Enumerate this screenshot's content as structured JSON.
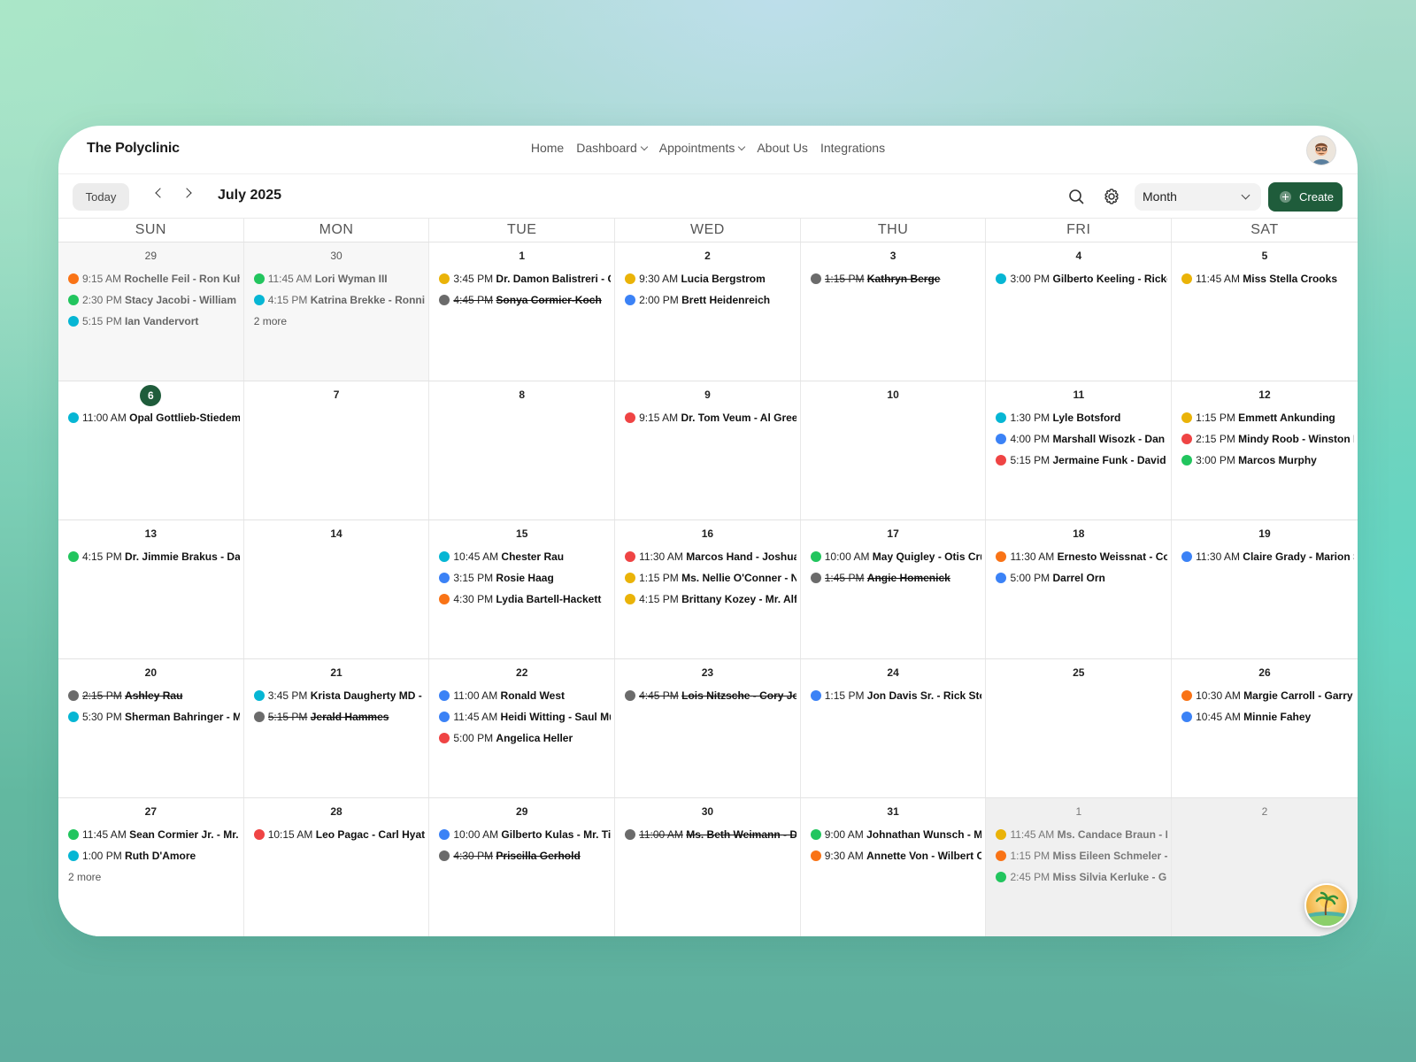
{
  "app": {
    "brand": "The Polyclinic"
  },
  "nav": {
    "items": [
      {
        "label": "Home",
        "dropdown": false
      },
      {
        "label": "Dashboard",
        "dropdown": true
      },
      {
        "label": "Appointments",
        "dropdown": true
      },
      {
        "label": "About Us",
        "dropdown": false
      },
      {
        "label": "Integrations",
        "dropdown": false
      }
    ]
  },
  "toolbar": {
    "today_label": "Today",
    "month_title": "July 2025",
    "view_value": "Month",
    "create_label": "Create"
  },
  "colors": {
    "orange": "#f97316",
    "green": "#22c55e",
    "cyan": "#06b6d4",
    "yellow": "#eab308",
    "gray": "#6b6b6b",
    "blue": "#3b82f6",
    "red": "#ef4444",
    "accent": "#1f5c3b"
  },
  "weekdays": [
    "SUN",
    "MON",
    "TUE",
    "WED",
    "THU",
    "FRI",
    "SAT"
  ],
  "weeks": [
    [
      {
        "day": "29",
        "type": "prev",
        "events": [
          {
            "time": "9:15 AM",
            "name": "Rochelle Feil - Ron Kuhic",
            "color": "orange"
          },
          {
            "time": "2:30 PM",
            "name": "Stacy Jacobi - William K",
            "color": "green"
          },
          {
            "time": "5:15 PM",
            "name": "Ian Vandervort",
            "color": "cyan"
          }
        ]
      },
      {
        "day": "30",
        "type": "prev",
        "events": [
          {
            "time": "11:45 AM",
            "name": "Lori Wyman III",
            "color": "green"
          },
          {
            "time": "4:15 PM",
            "name": "Katrina Brekke - Ronnie T",
            "color": "cyan"
          }
        ],
        "more": "2 more"
      },
      {
        "day": "1",
        "events": [
          {
            "time": "3:45 PM",
            "name": "Dr. Damon Balistreri - Cr",
            "color": "yellow"
          },
          {
            "time": "4:45 PM",
            "name": "Sonya Cormier-Koch",
            "color": "gray",
            "cancelled": true
          }
        ]
      },
      {
        "day": "2",
        "events": [
          {
            "time": "9:30 AM",
            "name": "Lucia Bergstrom",
            "color": "yellow"
          },
          {
            "time": "2:00 PM",
            "name": "Brett Heidenreich",
            "color": "blue"
          }
        ]
      },
      {
        "day": "3",
        "events": [
          {
            "time": "1:15 PM",
            "name": "Kathryn Berge",
            "color": "gray",
            "cancelled": true
          }
        ]
      },
      {
        "day": "4",
        "events": [
          {
            "time": "3:00 PM",
            "name": "Gilberto Keeling - Rickey",
            "color": "cyan"
          }
        ]
      },
      {
        "day": "5",
        "events": [
          {
            "time": "11:45 AM",
            "name": "Miss Stella Crooks",
            "color": "yellow"
          }
        ]
      }
    ],
    [
      {
        "day": "6",
        "today": true,
        "events": [
          {
            "time": "11:00 AM",
            "name": "Opal Gottlieb-Stiedemc",
            "color": "cyan"
          }
        ]
      },
      {
        "day": "7",
        "events": []
      },
      {
        "day": "8",
        "events": []
      },
      {
        "day": "9",
        "events": [
          {
            "time": "9:15 AM",
            "name": "Dr. Tom Veum - Al Green",
            "color": "red"
          }
        ]
      },
      {
        "day": "10",
        "events": []
      },
      {
        "day": "11",
        "events": [
          {
            "time": "1:30 PM",
            "name": "Lyle Botsford",
            "color": "cyan"
          },
          {
            "time": "4:00 PM",
            "name": "Marshall Wisozk - Dan T",
            "color": "blue"
          },
          {
            "time": "5:15 PM",
            "name": "Jermaine Funk - David Jo",
            "color": "red"
          }
        ]
      },
      {
        "day": "12",
        "events": [
          {
            "time": "1:15 PM",
            "name": "Emmett Ankunding",
            "color": "yellow"
          },
          {
            "time": "2:15 PM",
            "name": "Mindy Roob - Winston No",
            "color": "red"
          },
          {
            "time": "3:00 PM",
            "name": "Marcos Murphy",
            "color": "green"
          }
        ]
      }
    ],
    [
      {
        "day": "13",
        "events": [
          {
            "time": "4:15 PM",
            "name": "Dr. Jimmie Brakus - Dan J",
            "color": "green"
          }
        ]
      },
      {
        "day": "14",
        "events": []
      },
      {
        "day": "15",
        "events": [
          {
            "time": "10:45 AM",
            "name": "Chester Rau",
            "color": "cyan"
          },
          {
            "time": "3:15 PM",
            "name": "Rosie Haag",
            "color": "blue"
          },
          {
            "time": "4:30 PM",
            "name": "Lydia Bartell-Hackett",
            "color": "orange"
          }
        ]
      },
      {
        "day": "16",
        "events": [
          {
            "time": "11:30 AM",
            "name": "Marcos Hand - Joshua S",
            "color": "red"
          },
          {
            "time": "1:15 PM",
            "name": "Ms. Nellie O'Conner - Nick",
            "color": "yellow"
          },
          {
            "time": "4:15 PM",
            "name": "Brittany Kozey - Mr. Alfre",
            "color": "yellow"
          }
        ]
      },
      {
        "day": "17",
        "events": [
          {
            "time": "10:00 AM",
            "name": "May Quigley - Otis Cru",
            "color": "green"
          },
          {
            "time": "1:45 PM",
            "name": "Angie Homenick",
            "color": "gray",
            "cancelled": true
          }
        ]
      },
      {
        "day": "18",
        "events": [
          {
            "time": "11:30 AM",
            "name": "Ernesto Weissnat - Cour",
            "color": "orange"
          },
          {
            "time": "5:00 PM",
            "name": "Darrel Orn",
            "color": "blue"
          }
        ]
      },
      {
        "day": "19",
        "events": [
          {
            "time": "11:30 AM",
            "name": "Claire Grady - Marion S",
            "color": "blue"
          }
        ]
      }
    ],
    [
      {
        "day": "20",
        "events": [
          {
            "time": "2:15 PM",
            "name": "Ashley Rau",
            "color": "gray",
            "cancelled": true
          },
          {
            "time": "5:30 PM",
            "name": "Sherman Bahringer - Mr",
            "color": "cyan"
          }
        ]
      },
      {
        "day": "21",
        "events": [
          {
            "time": "3:45 PM",
            "name": "Krista Daugherty MD - M",
            "color": "cyan"
          },
          {
            "time": "5:15 PM",
            "name": "Jerald Hammes",
            "color": "gray",
            "cancelled": true
          }
        ]
      },
      {
        "day": "22",
        "events": [
          {
            "time": "11:00 AM",
            "name": "Ronald West",
            "color": "blue"
          },
          {
            "time": "11:45 AM",
            "name": "Heidi Witting - Saul Mulle",
            "color": "blue"
          },
          {
            "time": "5:00 PM",
            "name": "Angelica Heller",
            "color": "red"
          }
        ]
      },
      {
        "day": "23",
        "events": [
          {
            "time": "4:45 PM",
            "name": "Lois Nitzsche - Cory Jerd",
            "color": "gray",
            "cancelled": true
          }
        ]
      },
      {
        "day": "24",
        "events": [
          {
            "time": "1:15 PM",
            "name": "Jon Davis Sr. - Rick Stokes",
            "color": "blue"
          }
        ]
      },
      {
        "day": "25",
        "events": []
      },
      {
        "day": "26",
        "events": [
          {
            "time": "10:30 AM",
            "name": "Margie Carroll - Garry C",
            "color": "orange"
          },
          {
            "time": "10:45 AM",
            "name": "Minnie Fahey",
            "color": "blue"
          }
        ]
      }
    ],
    [
      {
        "day": "27",
        "events": [
          {
            "time": "11:45 AM",
            "name": "Sean Cormier Jr. - Mr. Je",
            "color": "green"
          },
          {
            "time": "1:00 PM",
            "name": "Ruth D'Amore",
            "color": "cyan"
          }
        ],
        "more": "2 more"
      },
      {
        "day": "28",
        "events": [
          {
            "time": "10:15 AM",
            "name": "Leo Pagac - Carl Hyatt",
            "color": "red"
          }
        ]
      },
      {
        "day": "29",
        "events": [
          {
            "time": "10:00 AM",
            "name": "Gilberto Kulas - Mr. Tim",
            "color": "blue"
          },
          {
            "time": "4:30 PM",
            "name": "Priscilla Gerhold",
            "color": "gray",
            "cancelled": true
          }
        ]
      },
      {
        "day": "30",
        "events": [
          {
            "time": "11:00 AM",
            "name": "Ms. Beth Weimann - De",
            "color": "gray",
            "cancelled": true
          }
        ]
      },
      {
        "day": "31",
        "events": [
          {
            "time": "9:00 AM",
            "name": "Johnathan Wunsch - Mc",
            "color": "green"
          },
          {
            "time": "9:30 AM",
            "name": "Annette Von - Wilbert O",
            "color": "orange"
          }
        ]
      },
      {
        "day": "1",
        "type": "next",
        "events": [
          {
            "time": "11:45 AM",
            "name": "Ms. Candace Braun - Elb",
            "color": "yellow"
          },
          {
            "time": "1:15 PM",
            "name": "Miss Eileen Schmeler - Au",
            "color": "orange"
          },
          {
            "time": "2:45 PM",
            "name": "Miss Silvia Kerluke - Gilb",
            "color": "green"
          }
        ]
      },
      {
        "day": "2",
        "type": "next",
        "events": []
      }
    ]
  ]
}
